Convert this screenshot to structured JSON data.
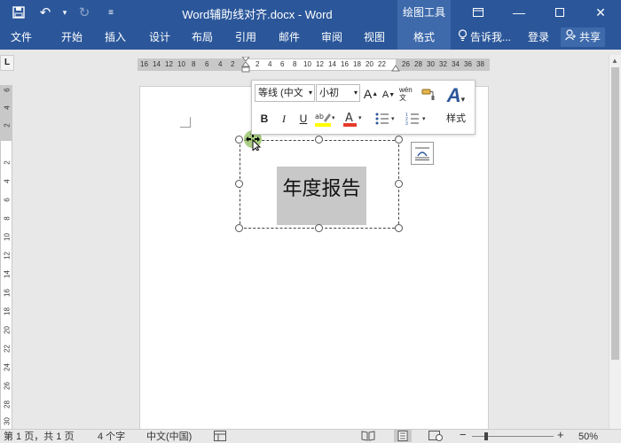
{
  "titlebar": {
    "doc_title": "Word辅助线对齐.docx - Word",
    "tools_label": "绘图工具"
  },
  "tabs": [
    "文件",
    "开始",
    "插入",
    "设计",
    "布局",
    "引用",
    "邮件",
    "审阅",
    "视图",
    "格式"
  ],
  "tellme": "告诉我...",
  "login": "登录",
  "share": "共享",
  "ruler": {
    "corner": "L",
    "left_numbers": [
      "16",
      "14",
      "12",
      "10",
      "8",
      "6",
      "4",
      "2"
    ],
    "center_numbers": [
      "2",
      "4",
      "6",
      "8",
      "10",
      "12",
      "14",
      "16",
      "18",
      "20",
      "22"
    ],
    "right_numbers": [
      "26",
      "28",
      "30",
      "32",
      "34",
      "36",
      "38"
    ],
    "vertical_numbers": [
      "6",
      "4",
      "2",
      "2",
      "4",
      "6",
      "8",
      "10",
      "12",
      "14",
      "16",
      "18",
      "20",
      "22",
      "24",
      "26",
      "28",
      "30"
    ]
  },
  "minitoolbar": {
    "font_name": "等线 (中文",
    "font_size": "小初",
    "grow_font": "A",
    "shrink_font": "A",
    "phonetic": "wén文",
    "bold": "B",
    "italic": "I",
    "underline": "U",
    "font_color": "A",
    "styles_label": "样式"
  },
  "textbox": {
    "text": "年度报告"
  },
  "status": {
    "page": "第 1 页，共 1 页",
    "words": "4 个字",
    "language": "中文(中国)",
    "zoom": "50%"
  },
  "colors": {
    "ribbon": "#2b579a",
    "active_tab": "#3e6aac",
    "textbox_fill": "#c8c8c8"
  }
}
